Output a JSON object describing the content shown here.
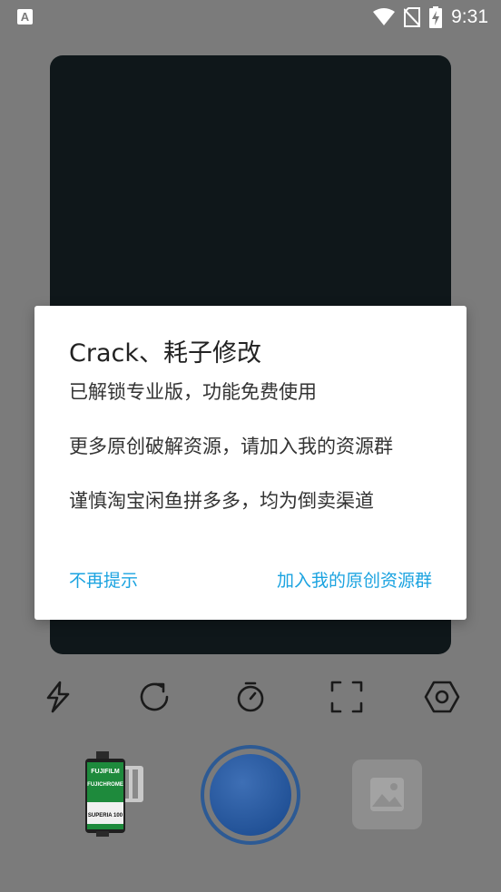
{
  "status_bar": {
    "time": "9:31",
    "left_icon_letter": "A",
    "icons": [
      "wifi-icon",
      "no-sim-icon",
      "battery-charging-icon"
    ]
  },
  "toolbar": {
    "icons": [
      "flash-icon",
      "rotate-icon",
      "timer-icon",
      "fullscreen-icon",
      "settings-hex-icon"
    ]
  },
  "film_roll": {
    "brand": "FUJIFILM",
    "model": "FUJICHROME",
    "label": "SUPERIA 100"
  },
  "dialog": {
    "title": "Crack、耗子修改",
    "message": "已解锁专业版，功能免费使用\n\n更多原创破解资源，请加入我的资源群\n\n谨慎淘宝闲鱼拼多多，均为倒卖渠道",
    "neutral_button": "不再提示",
    "positive_button": "加入我的原创资源群"
  },
  "colors": {
    "dim_background": "#7b7b7b",
    "viewfinder": "#0f171a",
    "accent": "#1ba3e0",
    "shutter": "#2b5fa8"
  }
}
